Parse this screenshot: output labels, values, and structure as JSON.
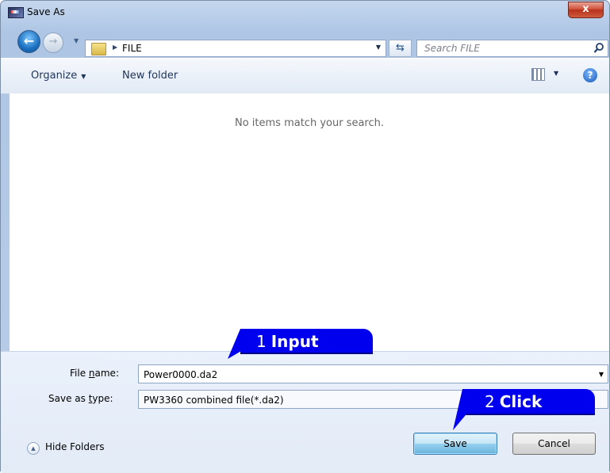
{
  "window": {
    "title": "Save As",
    "close_label": "x"
  },
  "nav": {
    "breadcrumb": "FILE",
    "search_placeholder": "Search FILE"
  },
  "toolbar": {
    "organize_label": "Organize",
    "new_folder_label": "New folder"
  },
  "content": {
    "empty_message": "No items match your search."
  },
  "form": {
    "file_name_label_pre": "File ",
    "file_name_label_u": "n",
    "file_name_label_post": "ame:",
    "file_name_value": "Power0000.da2",
    "save_type_label_pre": "Save as ",
    "save_type_label_u": "t",
    "save_type_label_post": "ype:",
    "save_type_value": "PW3360 combined file(*.da2)"
  },
  "footer": {
    "hide_folders_label": "Hide Folders",
    "save_label": "Save",
    "cancel_label": "Cancel"
  },
  "callouts": {
    "input_number": "1",
    "input_text": "Input",
    "click_number": "2",
    "click_text": "Click"
  }
}
